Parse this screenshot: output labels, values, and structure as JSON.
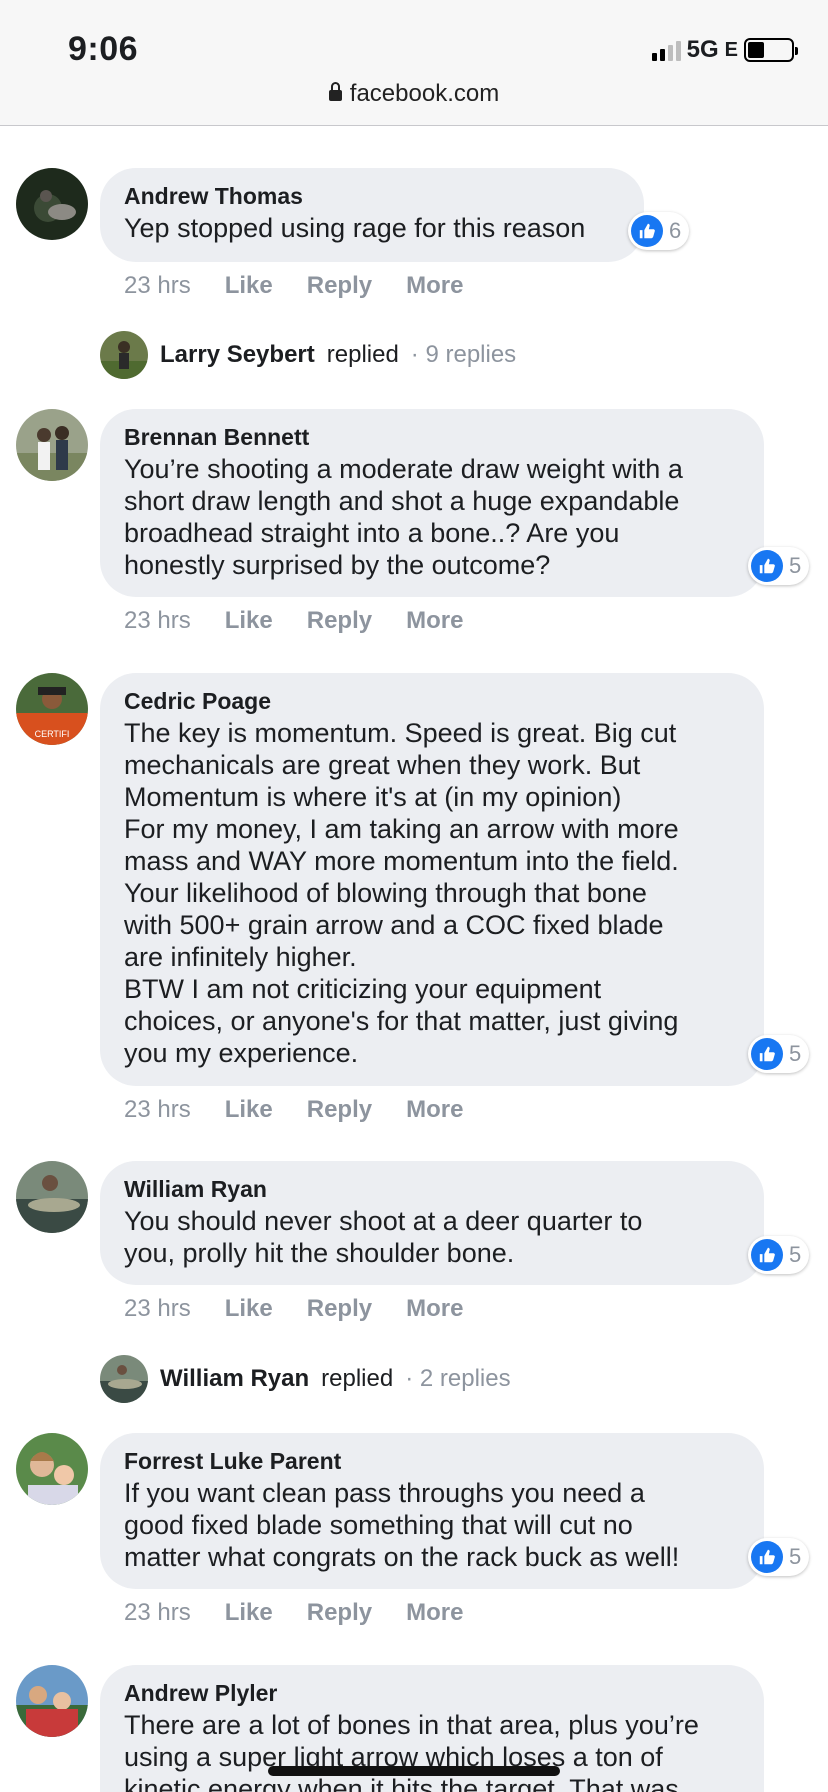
{
  "status": {
    "time": "9:06",
    "network": "5G",
    "network_suffix": "E"
  },
  "url": "facebook.com",
  "comments": [
    {
      "author": "Andrew Thomas",
      "text": "Yep stopped using rage for this reason",
      "likes": "6",
      "time": "23 hrs",
      "like_label": "Like",
      "reply_label": "Reply",
      "more_label": "More"
    },
    {
      "author": "Brennan Bennett",
      "text": "You’re shooting a moderate draw weight with a\nshort draw length and shot a huge expandable\nbroadhead straight into a bone..? Are you\nhonestly surprised by the outcome?",
      "likes": "5",
      "time": "23 hrs",
      "like_label": "Like",
      "reply_label": "Reply",
      "more_label": "More"
    },
    {
      "author": "Cedric Poage",
      "text": "The key is momentum. Speed is great. Big cut\nmechanicals are great when they work. But\nMomentum is where it's at (in my opinion)\nFor my money, I am taking an arrow with more\nmass and WAY more momentum into the field.\nYour likelihood of blowing through that bone\nwith 500+ grain arrow and a COC fixed blade\nare infinitely higher.\nBTW I am not criticizing your equipment\nchoices, or anyone's for that matter, just giving\nyou my experience.",
      "likes": "5",
      "time": "23 hrs",
      "like_label": "Like",
      "reply_label": "Reply",
      "more_label": "More"
    },
    {
      "author": "William Ryan",
      "text": "You should never shoot at a deer quarter to\nyou, prolly hit the shoulder bone.",
      "likes": "5",
      "time": "23 hrs",
      "like_label": "Like",
      "reply_label": "Reply",
      "more_label": "More"
    },
    {
      "author": "Forrest Luke Parent",
      "text": "If you want clean pass throughs you need a\ngood fixed blade something that will cut no\nmatter what congrats on the rack buck as well!",
      "likes": "5",
      "time": "23 hrs",
      "like_label": "Like",
      "reply_label": "Reply",
      "more_label": "More"
    },
    {
      "author": "Andrew Plyler",
      "text": "There are a lot of bones in that area, plus you’re\nusing a super light arrow which loses a ton of\nkinetic energy when it hits the target. That was"
    }
  ],
  "replies": [
    {
      "name": "Larry Seybert",
      "verb": "replied",
      "count": "· 9 replies"
    },
    {
      "name": "William Ryan",
      "verb": "replied",
      "count": "· 2 replies"
    }
  ],
  "colors": {
    "bubble": "#eceef2",
    "like_blue": "#1877f2",
    "meta_gray": "#8d949e"
  }
}
